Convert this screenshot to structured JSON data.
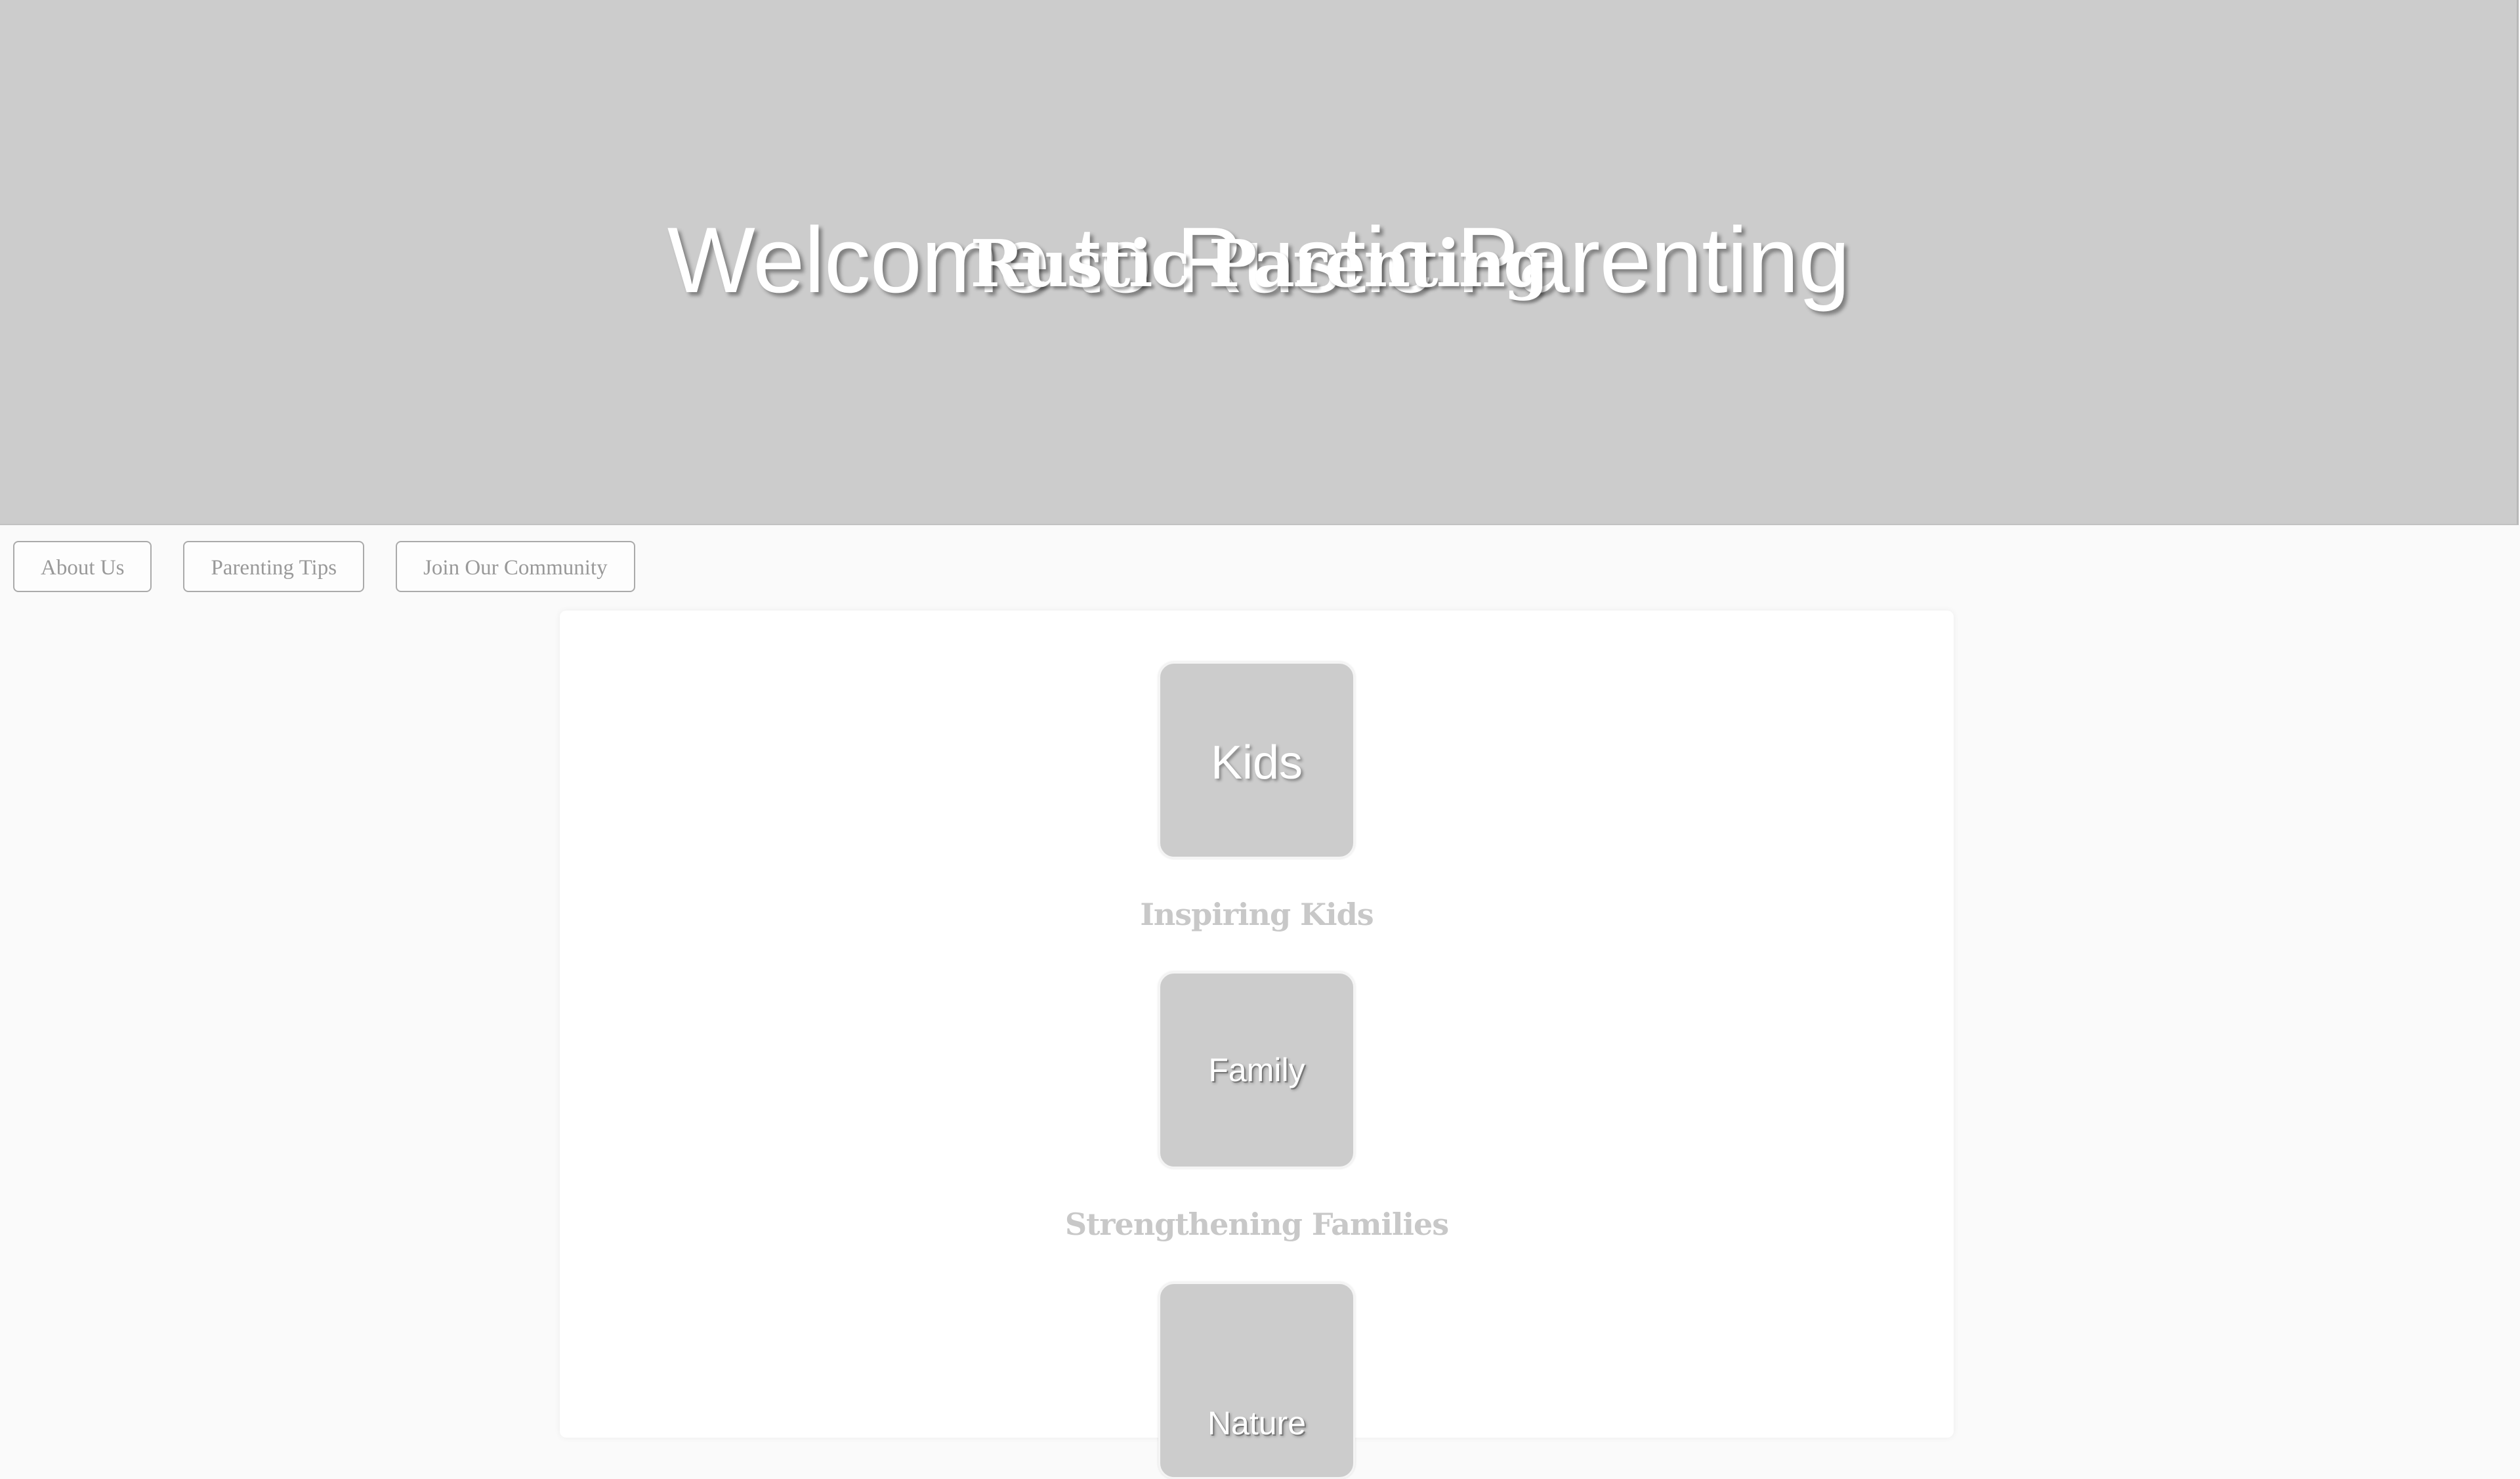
{
  "hero": {
    "welcome_heading": "Welcome to Rustic Parenting",
    "brand_heading": "Rustic Parenting"
  },
  "nav": {
    "items": [
      {
        "label": "About Us"
      },
      {
        "label": "Parenting Tips"
      },
      {
        "label": "Join Our Community"
      }
    ]
  },
  "features": [
    {
      "image_label": "Kids",
      "title": "Inspiring Kids"
    },
    {
      "image_label": "Family",
      "title": "Strengthening Families"
    },
    {
      "image_label": "Nature",
      "title": ""
    }
  ],
  "colors": {
    "hero_background": "#cccccc",
    "page_background": "#fafafa",
    "card_background": "#ffffff",
    "tile_background": "#cccccc",
    "nav_text": "#999999",
    "feature_title_text": "#c8c8c8"
  }
}
